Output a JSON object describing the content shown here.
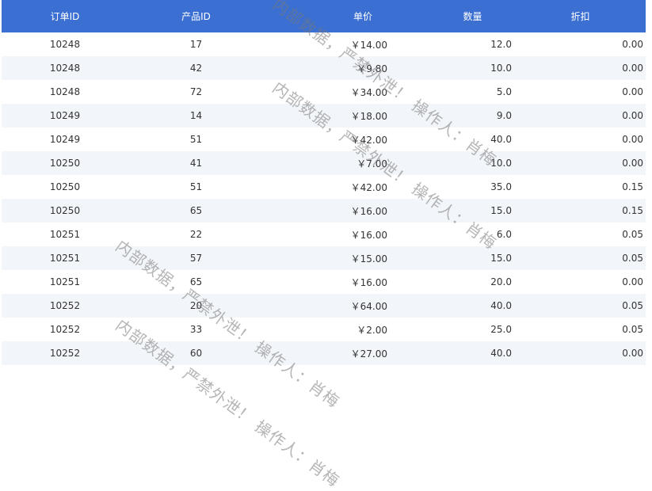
{
  "table": {
    "headers": [
      "订单ID",
      "产品ID",
      "单价",
      "数量",
      "折扣"
    ],
    "rows": [
      [
        "10248",
        "17",
        "￥14.00",
        "12.0",
        "0.00"
      ],
      [
        "10248",
        "42",
        "￥9.80",
        "10.0",
        "0.00"
      ],
      [
        "10248",
        "72",
        "￥34.00",
        "5.0",
        "0.00"
      ],
      [
        "10249",
        "14",
        "￥18.00",
        "9.0",
        "0.00"
      ],
      [
        "10249",
        "51",
        "￥42.00",
        "40.0",
        "0.00"
      ],
      [
        "10250",
        "41",
        "￥7.00",
        "10.0",
        "0.00"
      ],
      [
        "10250",
        "51",
        "￥42.00",
        "35.0",
        "0.15"
      ],
      [
        "10250",
        "65",
        "￥16.00",
        "15.0",
        "0.15"
      ],
      [
        "10251",
        "22",
        "￥16.00",
        "6.0",
        "0.05"
      ],
      [
        "10251",
        "57",
        "￥15.00",
        "15.0",
        "0.05"
      ],
      [
        "10251",
        "65",
        "￥16.00",
        "20.0",
        "0.00"
      ],
      [
        "10252",
        "20",
        "￥64.00",
        "40.0",
        "0.05"
      ],
      [
        "10252",
        "33",
        "￥2.00",
        "25.0",
        "0.05"
      ],
      [
        "10252",
        "60",
        "￥27.00",
        "40.0",
        "0.00"
      ]
    ]
  },
  "watermark": {
    "text": "内部数据，严禁外泄！ 操作人：肖梅"
  }
}
